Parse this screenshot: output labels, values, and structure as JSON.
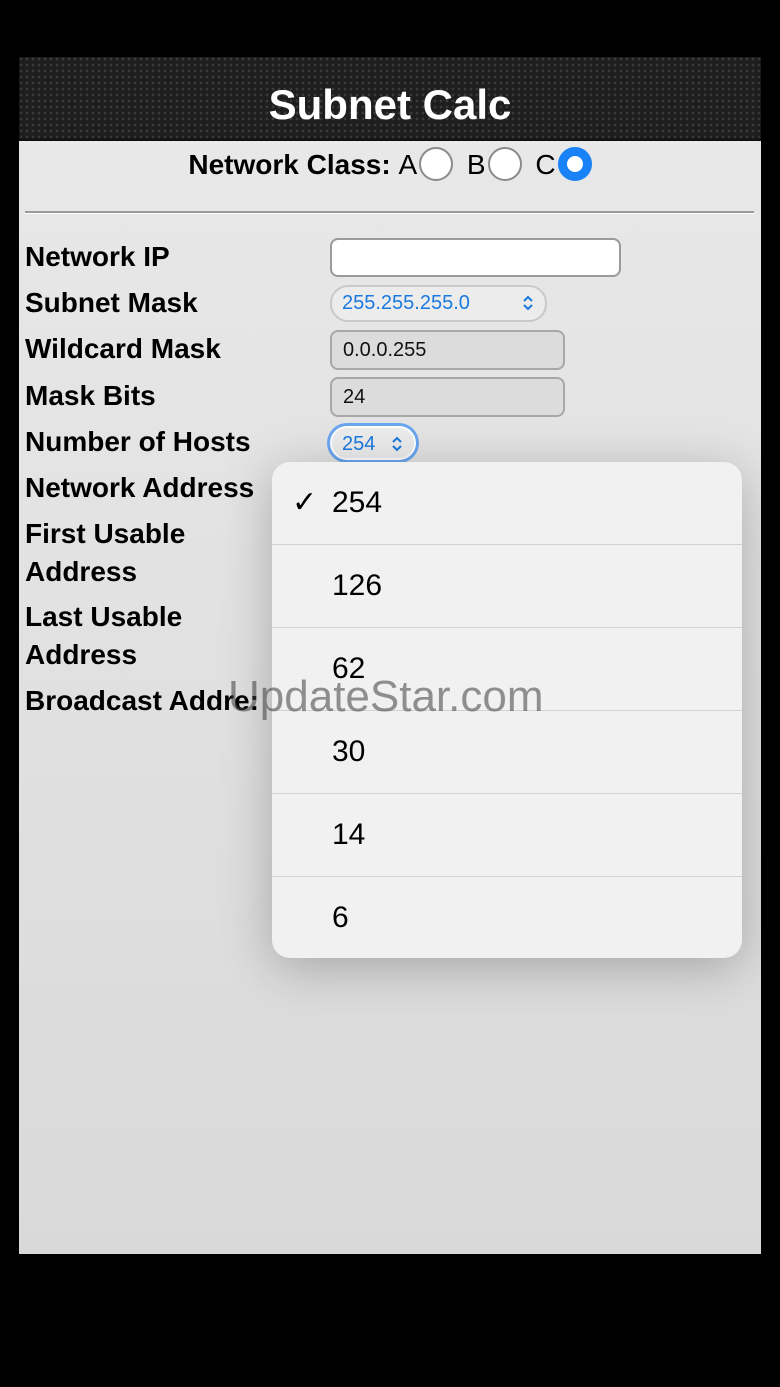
{
  "app": {
    "title": "Subnet Calc"
  },
  "network_class": {
    "label": "Network Class:",
    "options": [
      {
        "label": "A",
        "checked": false
      },
      {
        "label": "B",
        "checked": false
      },
      {
        "label": "C",
        "checked": true
      }
    ]
  },
  "form": {
    "network_ip": {
      "label": "Network IP",
      "value": ""
    },
    "subnet_mask": {
      "label": "Subnet Mask",
      "value": "255.255.255.0"
    },
    "wildcard_mask": {
      "label": "Wildcard Mask",
      "value": "0.0.0.255"
    },
    "mask_bits": {
      "label": "Mask Bits",
      "value": "24"
    },
    "number_of_hosts": {
      "label": "Number of Hosts",
      "value": "254"
    },
    "network_address": {
      "label": "Network Address"
    },
    "first_usable": {
      "label_line1": "First Usable",
      "label_line2": "Address"
    },
    "last_usable": {
      "label_line1": "Last Usable",
      "label_line2": "Address"
    },
    "broadcast_address": {
      "label": "Broadcast Addre:"
    }
  },
  "hosts_picker": {
    "selected": "254",
    "check_glyph": "✓",
    "options": [
      "254",
      "126",
      "62",
      "30",
      "14",
      "6"
    ]
  },
  "watermark": "UpdateStar.com",
  "colors": {
    "accent": "#1a82f7",
    "select_text": "#1a7ae0"
  }
}
